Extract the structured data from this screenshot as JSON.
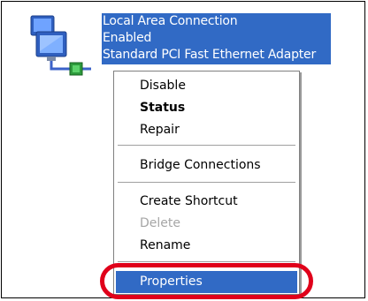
{
  "connection": {
    "icon": "network-connection-icon",
    "name": "Local Area Connection",
    "status": "Enabled",
    "device": "Standard PCI Fast Ethernet Adapter"
  },
  "context_menu": {
    "items": [
      {
        "label": "Disable"
      },
      {
        "label": "Status",
        "default": true
      },
      {
        "label": "Repair"
      },
      {
        "label": "Bridge Connections"
      },
      {
        "label": "Create Shortcut"
      },
      {
        "label": "Delete",
        "disabled": true
      },
      {
        "label": "Rename"
      },
      {
        "label": "Properties",
        "highlighted": true
      }
    ]
  },
  "colors": {
    "selection": "#316ac5",
    "callout": "#e0001a",
    "disabled_text": "#a6a6a6"
  }
}
